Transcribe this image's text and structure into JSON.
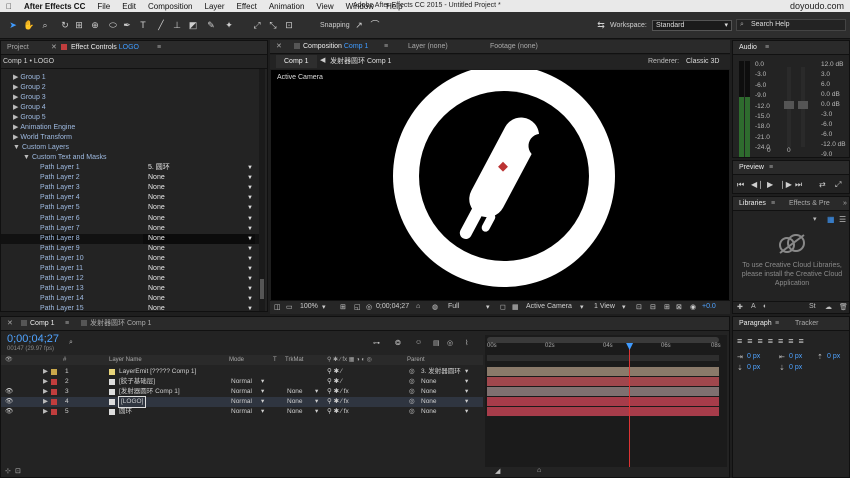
{
  "menubar": {
    "apple": "",
    "app": "After Effects CC",
    "items": [
      "File",
      "Edit",
      "Composition",
      "Layer",
      "Effect",
      "Animation",
      "View",
      "Window",
      "Help"
    ],
    "window_title": "Adobe After Effects CC 2015 - Untitled Project *",
    "brand": "doyoudo.com"
  },
  "toolbar": {
    "snapping": "Snapping",
    "workspace_label": "Workspace:",
    "workspace_value": "Standard",
    "search_placeholder": "Search Help"
  },
  "left_panel": {
    "tab_project": "Project",
    "tab_effect_controls": "Effect Controls",
    "effect_layer": "LOGO",
    "breadcrumb": "Comp 1 • LOGO",
    "tree": [
      {
        "label": "Group 1",
        "arrow": "▶"
      },
      {
        "label": "Group 2",
        "arrow": "▶"
      },
      {
        "label": "Group 3",
        "arrow": "▶"
      },
      {
        "label": "Group 4",
        "arrow": "▶"
      },
      {
        "label": "Group 5",
        "arrow": "▶"
      },
      {
        "label": "Animation Engine",
        "arrow": "▶"
      },
      {
        "label": "World Transform",
        "arrow": "▶"
      },
      {
        "label": "Custom Layers",
        "arrow": "▼"
      },
      {
        "label": "Custom Text and Masks",
        "arrow": "▼"
      }
    ],
    "path_layers": [
      {
        "label": "Path Layer 1",
        "value": "5. 圆环"
      },
      {
        "label": "Path Layer 2",
        "value": "None"
      },
      {
        "label": "Path Layer 3",
        "value": "None"
      },
      {
        "label": "Path Layer 4",
        "value": "None"
      },
      {
        "label": "Path Layer 5",
        "value": "None"
      },
      {
        "label": "Path Layer 6",
        "value": "None"
      },
      {
        "label": "Path Layer 7",
        "value": "None"
      },
      {
        "label": "Path Layer 8",
        "value": "None"
      },
      {
        "label": "Path Layer 9",
        "value": "None"
      },
      {
        "label": "Path Layer 10",
        "value": "None"
      },
      {
        "label": "Path Layer 11",
        "value": "None"
      },
      {
        "label": "Path Layer 12",
        "value": "None"
      },
      {
        "label": "Path Layer 13",
        "value": "None"
      },
      {
        "label": "Path Layer 14",
        "value": "None"
      },
      {
        "label": "Path Layer 15",
        "value": "None"
      }
    ]
  },
  "comp_panel": {
    "tab_composition": "Composition",
    "comp_name": "Comp 1",
    "tab_layer": "Layer (none)",
    "tab_footage": "Footage (none)",
    "subtab_comp1": "Comp 1",
    "subtab_second": "发射器圆环 Comp 1",
    "renderer_label": "Renderer:",
    "renderer_value": "Classic 3D",
    "camera_label": "Active Camera",
    "bottom": {
      "zoom": "100%",
      "timecode": "0;00;04;27",
      "quality": "Full",
      "camera": "Active Camera",
      "views": "1 View",
      "exposure": "+0.0"
    }
  },
  "audio": {
    "title": "Audio",
    "left_scale": [
      "0.0",
      "-3.0",
      "-6.0",
      "-9.0",
      "-12.0",
      "-15.0",
      "-18.0",
      "-21.0",
      "-24.0"
    ],
    "right_scale": [
      "12.0 dB",
      "6.0",
      "0.0 dB",
      "-6.0",
      "-12.0 dB"
    ],
    "right_scale2": [
      "3.0",
      "0.0 dB",
      "-3.0",
      "-6.0",
      "-9.0"
    ],
    "bottom_left": "0",
    "bottom_right": "0"
  },
  "preview": {
    "title": "Preview"
  },
  "libraries": {
    "tab_libraries": "Libraries",
    "tab_effects": "Effects & Pre",
    "message": "To use Creative Cloud Libraries, please install the Creative Cloud Application"
  },
  "timeline": {
    "tab_comp1": "Comp 1",
    "tab_second": "发射器圆环 Comp 1",
    "timecode": "0;00;04;27",
    "frame_info": "00147 (29.97 fps)",
    "columns": {
      "num": "#",
      "layer_name": "Layer Name",
      "mode": "Mode",
      "t": "T",
      "trkmat": "TrkMat",
      "parent": "Parent"
    },
    "ruler": [
      "00s",
      "02s",
      "04s",
      "06s",
      "08s"
    ],
    "playhead_sec": 4.9,
    "duration_sec": 8,
    "layers": [
      {
        "num": "1",
        "name": "LayerEmit [????? Comp 1]",
        "mode": "",
        "trkmat": "",
        "parent": "3. 发射器圆环",
        "color": "#c9a64a",
        "bar": "#8a7a6a",
        "start": 0,
        "end": 8
      },
      {
        "num": "2",
        "name": "[胶子基础层]",
        "mode": "Normal",
        "trkmat": "",
        "parent": "None",
        "color": "#c03d3d",
        "bar": "#a0474d",
        "start": 0,
        "end": 8
      },
      {
        "num": "3",
        "name": "[发射器圆环 Comp 1]",
        "mode": "Normal",
        "trkmat": "None",
        "parent": "None",
        "color": "#c03d3d",
        "bar": "#7f7070",
        "start": 0,
        "end": 8
      },
      {
        "num": "4",
        "name": "[LOGO]",
        "mode": "Normal",
        "trkmat": "None",
        "parent": "None",
        "color": "#c03d3d",
        "bar": "#a73c4a",
        "start": 0,
        "end": 8
      },
      {
        "num": "5",
        "name": "圆环",
        "mode": "Normal",
        "trkmat": "None",
        "parent": "None",
        "color": "#c03d3d",
        "bar": "#a73c4a",
        "start": 0,
        "end": 8
      }
    ]
  },
  "paragraph": {
    "tab_paragraph": "Paragraph",
    "tab_tracker": "Tracker",
    "fields": [
      "0 px",
      "0 px",
      "0 px",
      "0 px",
      "0 px"
    ]
  }
}
